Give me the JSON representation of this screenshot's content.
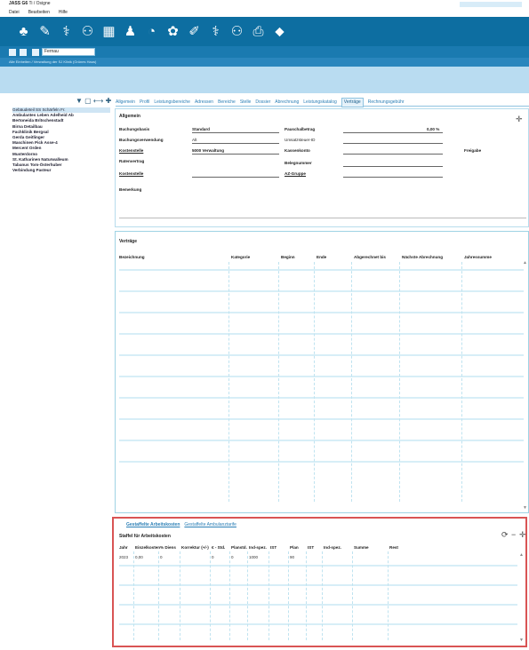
{
  "app": {
    "title": "JASS G6",
    "subtitle": "Ti / Osigne"
  },
  "menu": [
    "Datei",
    "Bearbeiten",
    "Hilfe"
  ],
  "toolbar_icons": [
    "users-icon",
    "pen-icon",
    "stethoscope-icon",
    "sitemap-icon",
    "calendar-icon",
    "person-icon",
    "chart-pie-icon",
    "gear-icon",
    "edit-icon",
    "doctor-icon",
    "network-icon",
    "printer-icon",
    "tag-icon"
  ],
  "toolbar_glyphs": [
    "♣",
    "✎",
    "⚕",
    "⚇",
    "▦",
    "♟",
    "◔",
    "✿",
    "✐",
    "⚕",
    "⚇",
    "⎙",
    "⬥"
  ],
  "address": {
    "value": "Fernau",
    "breadcrumb": "Alle Einheiten / Verwaltung der SJ Klinik (Grünes Haus)"
  },
  "tree_toolbar": "▼ ▢ ⟷ ✚",
  "sidebar": {
    "items": [
      {
        "label": "Gebäudeteil SS Schärfeln Fr.",
        "selected": true
      },
      {
        "label": "Ambulantes Leben Adelheid Ab",
        "selected": false
      },
      {
        "label": "Bertoneida Britschenstadt",
        "selected": false
      },
      {
        "label": "Birna Detailbau",
        "selected": false
      },
      {
        "label": "Fachklinik Bergsal",
        "selected": false
      },
      {
        "label": "Gerda Geitlinger",
        "selected": false
      },
      {
        "label": "Maschinen Pick Asse-4",
        "selected": false
      },
      {
        "label": "Mercent Orden",
        "selected": false
      },
      {
        "label": "Musterdorno",
        "selected": false
      },
      {
        "label": "St. Katharinen Naturwalleum",
        "selected": false
      },
      {
        "label": "Tabanus Tom-Österhuber",
        "selected": false
      },
      {
        "label": "Verbindung Pasteur",
        "selected": false
      }
    ]
  },
  "tabs": [
    {
      "label": "Allgemein",
      "active": false
    },
    {
      "label": "Profil",
      "active": false
    },
    {
      "label": "Leistungsbereiche",
      "active": false
    },
    {
      "label": "Adressen",
      "active": false
    },
    {
      "label": "Bereiche",
      "active": false
    },
    {
      "label": "Stelle",
      "active": false
    },
    {
      "label": "Dossier",
      "active": false
    },
    {
      "label": "Abrechnung",
      "active": false
    },
    {
      "label": "Leistungskatalog",
      "active": false
    },
    {
      "label": "Verträge",
      "active": true
    },
    {
      "label": "Rechnungsgebühr",
      "active": false
    }
  ],
  "general": {
    "title": "Allgemein",
    "fields": {
      "buchungsbasis_label": "Buchungsbasis",
      "buchungsbasis_value": "Standard",
      "buchungsverwendung_label": "Buchungsverwendung",
      "buchungsverwendung_value": "Alt",
      "kostenstelle_label": "Kostenstelle",
      "kostenstelle_value": "5000 Verwaltung",
      "ratenvertrag_label": "Ratenvertrag",
      "kostenstelle2_label": "Kostenstelle",
      "bemerkung_label": "Bemerkung",
      "pauschal_label": "Pauschalbetrag",
      "pauschal_value": "0,00 %",
      "umsatzsteuer_label": "Umsatzsteuer-ID",
      "kassenkonto_label": "Kassenkonto",
      "belegnummer_label": "Belegnummer",
      "az_label": "AZ-Gruppe",
      "freigabe_label": "Freigabe"
    }
  },
  "contracts": {
    "title": "Verträge",
    "columns": [
      "Bezeichnung",
      "Kategorie",
      "Beginn",
      "Ende",
      "Abgerechnet bis",
      "Nächste Abrechnung",
      "Jahressumme"
    ]
  },
  "calc": {
    "tabs": [
      {
        "label": "Gestaffelte Arbeitskosten",
        "active": true
      },
      {
        "label": "Gestaffelte Ambulanztarife",
        "active": false
      }
    ],
    "subtitle": "Staffel für Arbeitskosten",
    "columns": [
      "Jahr",
      "Einzelkosten",
      "% Diens",
      "Korrektur (+/-)",
      "€ - Std.",
      "Planstd.",
      "Ind-spez.",
      "IST",
      "Plan",
      "IST",
      "Ind-spez.",
      "Summe",
      "Rest"
    ],
    "first_row": [
      "2023",
      "0,00",
      "0",
      "",
      "0",
      "0",
      "1000",
      "",
      "90"
    ]
  }
}
